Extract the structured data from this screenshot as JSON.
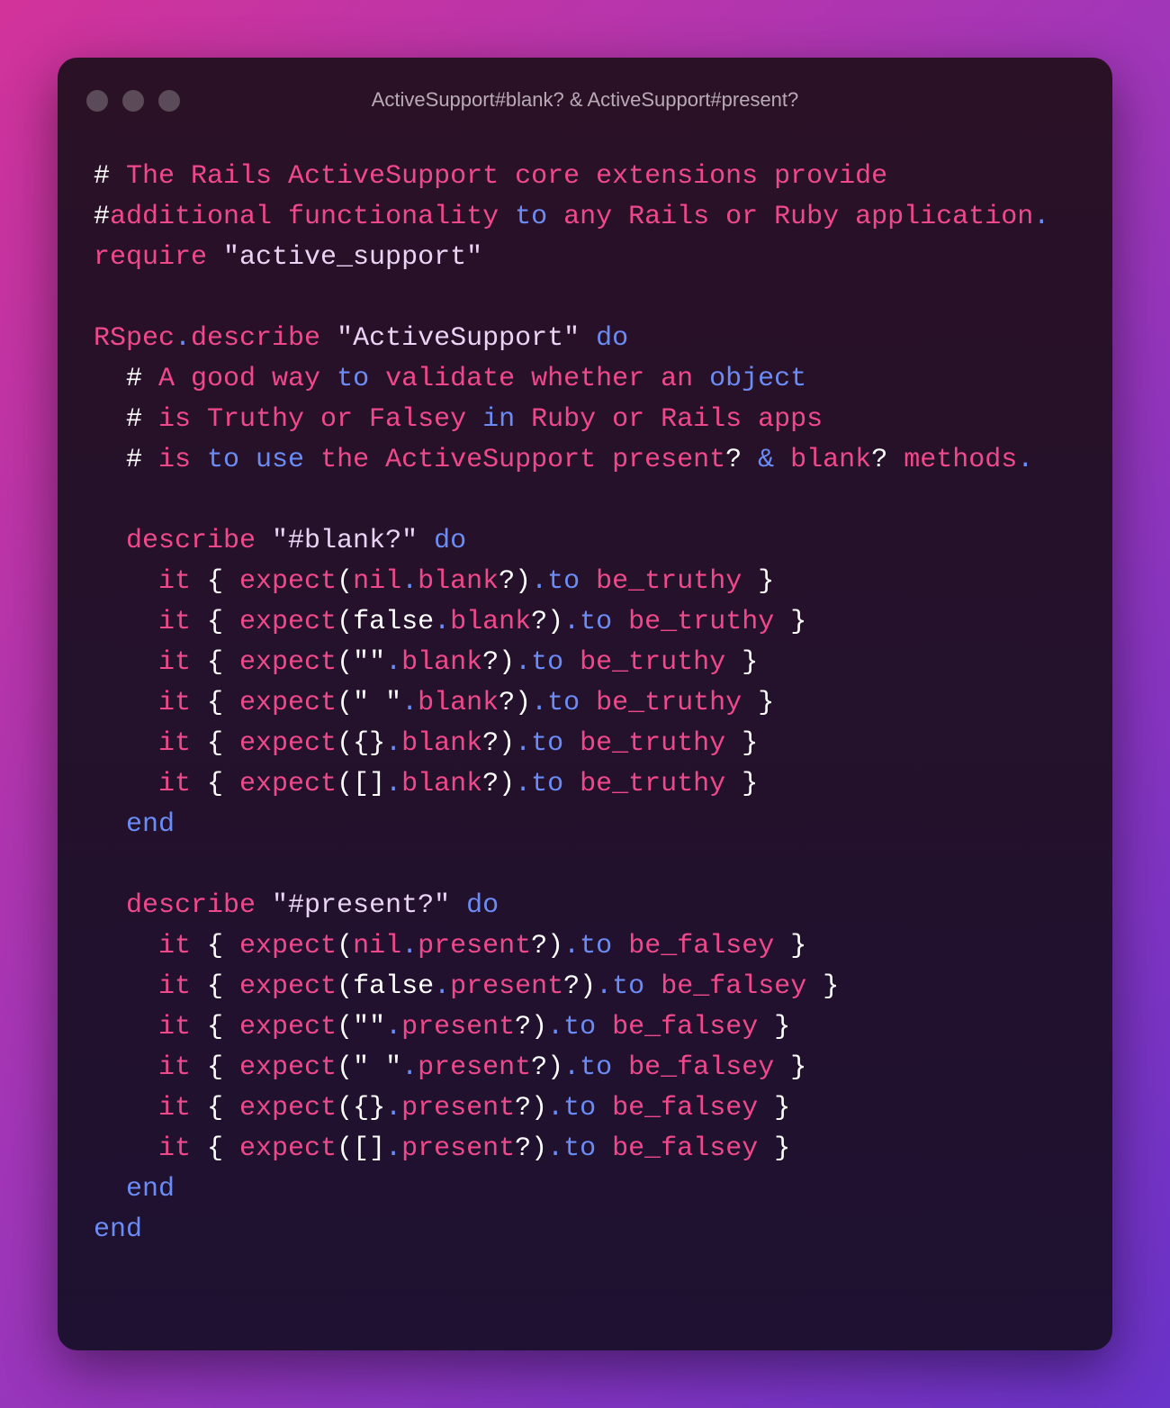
{
  "window": {
    "title": "ActiveSupport#blank? & ActiveSupport#present?"
  },
  "code_lines": [
    [
      {
        "t": "# ",
        "c": "hash"
      },
      {
        "t": "The Rails ActiveSupport core extensions provide",
        "c": "pink"
      }
    ],
    [
      {
        "t": "#",
        "c": "hash"
      },
      {
        "t": "additional functionality ",
        "c": "pink"
      },
      {
        "t": "to",
        "c": "blue"
      },
      {
        "t": " any Rails or Ruby application",
        "c": "pink"
      },
      {
        "t": ".",
        "c": "blue"
      }
    ],
    [
      {
        "t": "require ",
        "c": "pink"
      },
      {
        "t": "\"active_support\"",
        "c": "str"
      }
    ],
    [],
    [
      {
        "t": "RSpec",
        "c": "pink"
      },
      {
        "t": ".",
        "c": "blue"
      },
      {
        "t": "describe ",
        "c": "pink"
      },
      {
        "t": "\"ActiveSupport\"",
        "c": "str"
      },
      {
        "t": " do",
        "c": "blue"
      }
    ],
    [
      {
        "t": "  # ",
        "c": "hash"
      },
      {
        "t": "A good way ",
        "c": "pink"
      },
      {
        "t": "to",
        "c": "blue"
      },
      {
        "t": " validate whether an ",
        "c": "pink"
      },
      {
        "t": "object",
        "c": "blue"
      }
    ],
    [
      {
        "t": "  # ",
        "c": "hash"
      },
      {
        "t": "is Truthy or Falsey ",
        "c": "pink"
      },
      {
        "t": "in",
        "c": "blue"
      },
      {
        "t": " Ruby or Rails apps",
        "c": "pink"
      }
    ],
    [
      {
        "t": "  # ",
        "c": "hash"
      },
      {
        "t": "is ",
        "c": "pink"
      },
      {
        "t": "to use",
        "c": "blue"
      },
      {
        "t": " the ActiveSupport present",
        "c": "pink"
      },
      {
        "t": "? ",
        "c": "white"
      },
      {
        "t": "&",
        "c": "blue"
      },
      {
        "t": " blank",
        "c": "pink"
      },
      {
        "t": "? ",
        "c": "white"
      },
      {
        "t": "methods",
        "c": "pink"
      },
      {
        "t": ".",
        "c": "blue"
      }
    ],
    [],
    [
      {
        "t": "  describe ",
        "c": "pink"
      },
      {
        "t": "\"#blank?\"",
        "c": "str"
      },
      {
        "t": " do",
        "c": "blue"
      }
    ],
    [
      {
        "t": "    it ",
        "c": "pink"
      },
      {
        "t": "{ ",
        "c": "white"
      },
      {
        "t": "expect",
        "c": "pink"
      },
      {
        "t": "(",
        "c": "white"
      },
      {
        "t": "nil",
        "c": "pink"
      },
      {
        "t": ".",
        "c": "blue"
      },
      {
        "t": "blank",
        "c": "pink"
      },
      {
        "t": "?)",
        "c": "white"
      },
      {
        "t": ".to",
        "c": "blue"
      },
      {
        "t": " be_truthy ",
        "c": "pink"
      },
      {
        "t": "}",
        "c": "white"
      }
    ],
    [
      {
        "t": "    it ",
        "c": "pink"
      },
      {
        "t": "{ ",
        "c": "white"
      },
      {
        "t": "expect",
        "c": "pink"
      },
      {
        "t": "(false",
        "c": "white"
      },
      {
        "t": ".",
        "c": "blue"
      },
      {
        "t": "blank",
        "c": "pink"
      },
      {
        "t": "?)",
        "c": "white"
      },
      {
        "t": ".to",
        "c": "blue"
      },
      {
        "t": " be_truthy ",
        "c": "pink"
      },
      {
        "t": "}",
        "c": "white"
      }
    ],
    [
      {
        "t": "    it ",
        "c": "pink"
      },
      {
        "t": "{ ",
        "c": "white"
      },
      {
        "t": "expect",
        "c": "pink"
      },
      {
        "t": "(\"\"",
        "c": "white"
      },
      {
        "t": ".",
        "c": "blue"
      },
      {
        "t": "blank",
        "c": "pink"
      },
      {
        "t": "?)",
        "c": "white"
      },
      {
        "t": ".to",
        "c": "blue"
      },
      {
        "t": " be_truthy ",
        "c": "pink"
      },
      {
        "t": "}",
        "c": "white"
      }
    ],
    [
      {
        "t": "    it ",
        "c": "pink"
      },
      {
        "t": "{ ",
        "c": "white"
      },
      {
        "t": "expect",
        "c": "pink"
      },
      {
        "t": "(\" \"",
        "c": "white"
      },
      {
        "t": ".",
        "c": "blue"
      },
      {
        "t": "blank",
        "c": "pink"
      },
      {
        "t": "?)",
        "c": "white"
      },
      {
        "t": ".to",
        "c": "blue"
      },
      {
        "t": " be_truthy ",
        "c": "pink"
      },
      {
        "t": "}",
        "c": "white"
      }
    ],
    [
      {
        "t": "    it ",
        "c": "pink"
      },
      {
        "t": "{ ",
        "c": "white"
      },
      {
        "t": "expect",
        "c": "pink"
      },
      {
        "t": "({}",
        "c": "white"
      },
      {
        "t": ".",
        "c": "blue"
      },
      {
        "t": "blank",
        "c": "pink"
      },
      {
        "t": "?)",
        "c": "white"
      },
      {
        "t": ".to",
        "c": "blue"
      },
      {
        "t": " be_truthy ",
        "c": "pink"
      },
      {
        "t": "}",
        "c": "white"
      }
    ],
    [
      {
        "t": "    it ",
        "c": "pink"
      },
      {
        "t": "{ ",
        "c": "white"
      },
      {
        "t": "expect",
        "c": "pink"
      },
      {
        "t": "([]",
        "c": "white"
      },
      {
        "t": ".",
        "c": "blue"
      },
      {
        "t": "blank",
        "c": "pink"
      },
      {
        "t": "?)",
        "c": "white"
      },
      {
        "t": ".to",
        "c": "blue"
      },
      {
        "t": " be_truthy ",
        "c": "pink"
      },
      {
        "t": "}",
        "c": "white"
      }
    ],
    [
      {
        "t": "  end",
        "c": "blue"
      }
    ],
    [],
    [
      {
        "t": "  describe ",
        "c": "pink"
      },
      {
        "t": "\"#present?\"",
        "c": "str"
      },
      {
        "t": " do",
        "c": "blue"
      }
    ],
    [
      {
        "t": "    it ",
        "c": "pink"
      },
      {
        "t": "{ ",
        "c": "white"
      },
      {
        "t": "expect",
        "c": "pink"
      },
      {
        "t": "(",
        "c": "white"
      },
      {
        "t": "nil",
        "c": "pink"
      },
      {
        "t": ".",
        "c": "blue"
      },
      {
        "t": "present",
        "c": "pink"
      },
      {
        "t": "?)",
        "c": "white"
      },
      {
        "t": ".to",
        "c": "blue"
      },
      {
        "t": " be_falsey ",
        "c": "pink"
      },
      {
        "t": "}",
        "c": "white"
      }
    ],
    [
      {
        "t": "    it ",
        "c": "pink"
      },
      {
        "t": "{ ",
        "c": "white"
      },
      {
        "t": "expect",
        "c": "pink"
      },
      {
        "t": "(false",
        "c": "white"
      },
      {
        "t": ".",
        "c": "blue"
      },
      {
        "t": "present",
        "c": "pink"
      },
      {
        "t": "?)",
        "c": "white"
      },
      {
        "t": ".to",
        "c": "blue"
      },
      {
        "t": " be_falsey ",
        "c": "pink"
      },
      {
        "t": "}",
        "c": "white"
      }
    ],
    [
      {
        "t": "    it ",
        "c": "pink"
      },
      {
        "t": "{ ",
        "c": "white"
      },
      {
        "t": "expect",
        "c": "pink"
      },
      {
        "t": "(\"\"",
        "c": "white"
      },
      {
        "t": ".",
        "c": "blue"
      },
      {
        "t": "present",
        "c": "pink"
      },
      {
        "t": "?)",
        "c": "white"
      },
      {
        "t": ".to",
        "c": "blue"
      },
      {
        "t": " be_falsey ",
        "c": "pink"
      },
      {
        "t": "}",
        "c": "white"
      }
    ],
    [
      {
        "t": "    it ",
        "c": "pink"
      },
      {
        "t": "{ ",
        "c": "white"
      },
      {
        "t": "expect",
        "c": "pink"
      },
      {
        "t": "(\" \"",
        "c": "white"
      },
      {
        "t": ".",
        "c": "blue"
      },
      {
        "t": "present",
        "c": "pink"
      },
      {
        "t": "?)",
        "c": "white"
      },
      {
        "t": ".to",
        "c": "blue"
      },
      {
        "t": " be_falsey ",
        "c": "pink"
      },
      {
        "t": "}",
        "c": "white"
      }
    ],
    [
      {
        "t": "    it ",
        "c": "pink"
      },
      {
        "t": "{ ",
        "c": "white"
      },
      {
        "t": "expect",
        "c": "pink"
      },
      {
        "t": "({}",
        "c": "white"
      },
      {
        "t": ".",
        "c": "blue"
      },
      {
        "t": "present",
        "c": "pink"
      },
      {
        "t": "?)",
        "c": "white"
      },
      {
        "t": ".to",
        "c": "blue"
      },
      {
        "t": " be_falsey ",
        "c": "pink"
      },
      {
        "t": "}",
        "c": "white"
      }
    ],
    [
      {
        "t": "    it ",
        "c": "pink"
      },
      {
        "t": "{ ",
        "c": "white"
      },
      {
        "t": "expect",
        "c": "pink"
      },
      {
        "t": "([]",
        "c": "white"
      },
      {
        "t": ".",
        "c": "blue"
      },
      {
        "t": "present",
        "c": "pink"
      },
      {
        "t": "?)",
        "c": "white"
      },
      {
        "t": ".to",
        "c": "blue"
      },
      {
        "t": " be_falsey ",
        "c": "pink"
      },
      {
        "t": "}",
        "c": "white"
      }
    ],
    [
      {
        "t": "  end",
        "c": "blue"
      }
    ],
    [
      {
        "t": "end",
        "c": "blue"
      }
    ]
  ]
}
